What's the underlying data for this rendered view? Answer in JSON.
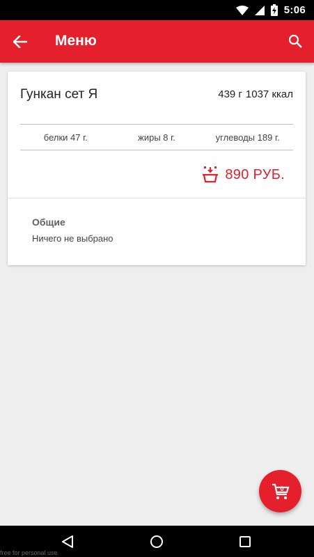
{
  "status_bar": {
    "time": "5:06",
    "icons": [
      "wifi-icon",
      "signal-icon",
      "battery-charging-icon"
    ]
  },
  "app_bar": {
    "title": "Меню",
    "back_icon": "arrow-left-icon",
    "search_icon": "search-icon",
    "background": "#e3202b"
  },
  "product": {
    "name": "Гункан сет Я",
    "weight": "439 г",
    "calories": "1037 ккал",
    "nutrition": {
      "proteins": "белки 47 г.",
      "fats": "жиры 8 г.",
      "carbs": "углеводы 189 г."
    },
    "price": "890 РУБ.",
    "add_icon": "add-to-basket-icon"
  },
  "options": {
    "title": "Общие",
    "value": "Ничего не выбрано"
  },
  "fab": {
    "icon": "cart-icon",
    "badge_count": "0"
  },
  "nav_bar": {
    "icons": [
      "back-triangle-icon",
      "home-circle-icon",
      "recent-square-icon"
    ]
  },
  "watermark": "free for personal use"
}
